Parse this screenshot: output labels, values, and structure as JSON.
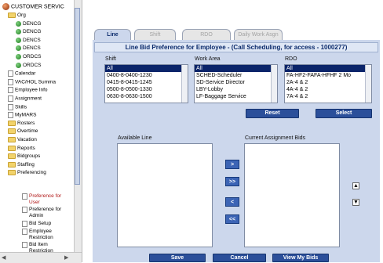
{
  "tree": {
    "root_label": "CUSTOMER SERVIC",
    "nodes": [
      {
        "label": "Org",
        "kind": "folder"
      },
      {
        "label": "DENCG",
        "kind": "dot"
      },
      {
        "label": "DENCG",
        "kind": "dot"
      },
      {
        "label": "DENCS",
        "kind": "dot"
      },
      {
        "label": "DENCS",
        "kind": "dot"
      },
      {
        "label": "ORDCS",
        "kind": "dot"
      },
      {
        "label": "ORDCS",
        "kind": "dot"
      },
      {
        "label": "Calendar",
        "kind": "doc"
      },
      {
        "label": "VAC/HOL Summa",
        "kind": "doc"
      },
      {
        "label": "Employee Info",
        "kind": "doc"
      },
      {
        "label": "Assignment",
        "kind": "doc"
      },
      {
        "label": "Skills",
        "kind": "doc"
      },
      {
        "label": "MyMARS",
        "kind": "doc"
      },
      {
        "label": "Rosters",
        "kind": "folder"
      },
      {
        "label": "Overtime",
        "kind": "folder"
      },
      {
        "label": "Vacation",
        "kind": "folder"
      },
      {
        "label": "Reports",
        "kind": "folder"
      },
      {
        "label": "Bidgroups",
        "kind": "folder"
      },
      {
        "label": "Staffing",
        "kind": "folder"
      },
      {
        "label": "Preferencing",
        "kind": "folder"
      }
    ],
    "leaves": [
      {
        "line1": "Preference for",
        "line2": "User",
        "red": true
      },
      {
        "line1": "Preference for",
        "line2": "Admin",
        "red": false
      },
      {
        "line1": "Bid Setup",
        "line2": "",
        "red": false
      },
      {
        "line1": "Employee",
        "line2": "Restriction",
        "red": false
      },
      {
        "line1": "Bid Item",
        "line2": "Restriction",
        "red": false
      }
    ]
  },
  "tabs": [
    {
      "label": "Line",
      "active": true
    },
    {
      "label": "Shift",
      "active": false
    },
    {
      "label": "RDO",
      "active": false
    },
    {
      "label": "Daily Work Asgn",
      "active": false
    }
  ],
  "title": "Line Bid Preference for Employee - (Call Scheduling, for access - 1000277)",
  "shift": {
    "label": "Shift",
    "options": [
      "All",
      "0400-8-0400-1230",
      "0415-8-0415-1245",
      "0500-8-0500-1330",
      "0630-8-0630-1500"
    ]
  },
  "work_area": {
    "label": "Work Area",
    "options": [
      "All",
      "SCHED-Scheduler",
      "SD-Service Director",
      "LBY-Lobby",
      "LF-Baggage Service"
    ]
  },
  "rdo": {
    "label": "RDO",
    "options": [
      "All",
      "FA-HF2-FAFA-HFHF 2 Mo",
      "2A-4 & 2",
      "4A-4 & 2",
      "7A-4 & 2"
    ]
  },
  "buttons": {
    "reset": "Reset",
    "select": "Select",
    "move_right": ">",
    "move_all_right": ">>",
    "move_left": "<",
    "move_all_left": "<<",
    "save": "Save",
    "cancel": "Cancel",
    "view_my_bids": "View My Bids"
  },
  "available_line": {
    "label": "Available Line"
  },
  "current_bids": {
    "label": "Current Assignment Bids"
  },
  "colors": {
    "accent": "#2b4f9a",
    "panel": "#ccd7ec",
    "title_text": "#0a2a6b",
    "selected_row": "#0a246a"
  }
}
